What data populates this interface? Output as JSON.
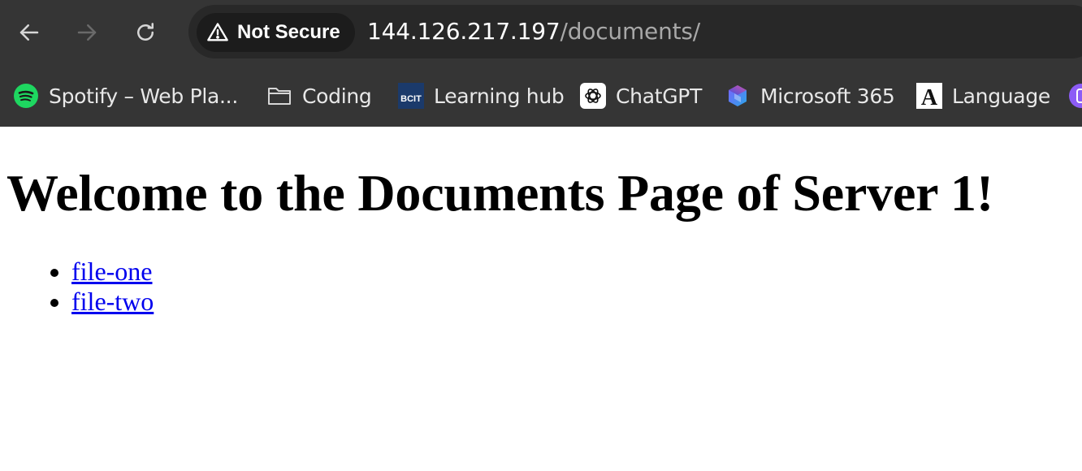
{
  "browser": {
    "security_label": "Not Secure",
    "url_host": "144.126.217.197",
    "url_path": "/documents/"
  },
  "bookmarks": [
    {
      "label": "Spotify – Web Pla...",
      "icon": "spotify-icon"
    },
    {
      "label": "Coding",
      "icon": "folder-icon"
    },
    {
      "label": "Learning hub",
      "icon": "bcit-icon"
    },
    {
      "label": "ChatGPT",
      "icon": "chatgpt-icon"
    },
    {
      "label": "Microsoft 365",
      "icon": "microsoft-365-icon"
    },
    {
      "label": "Language",
      "icon": "language-icon"
    }
  ],
  "icons": {
    "bcit_text": "BCIT",
    "language_letter": "A"
  },
  "page": {
    "heading": "Welcome to the Documents Page of Server 1!",
    "links": [
      "file-one",
      "file-two"
    ]
  },
  "colors": {
    "toolbar_bg": "#353535",
    "omnibox_bg": "#282828",
    "link": "#0000ee",
    "spotify": "#1ed760",
    "bcit": "#1b3a6b",
    "extension": "#8c5cf6"
  }
}
